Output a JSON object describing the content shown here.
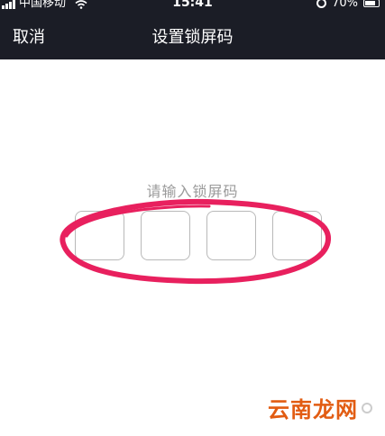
{
  "status_bar": {
    "carrier": "中国移动",
    "time": "15:41",
    "battery": "70%"
  },
  "nav": {
    "cancel_label": "取消",
    "title": "设置锁屏码"
  },
  "main": {
    "prompt": "请输入锁屏码",
    "code_boxes": 4
  },
  "annotation": {
    "color": "#e8205e"
  },
  "watermark": {
    "text": "云南龙网"
  },
  "colors": {
    "header_bg": "#1b1d26",
    "box_border": "#b9b9b9",
    "prompt_text": "#9a9a9a"
  }
}
